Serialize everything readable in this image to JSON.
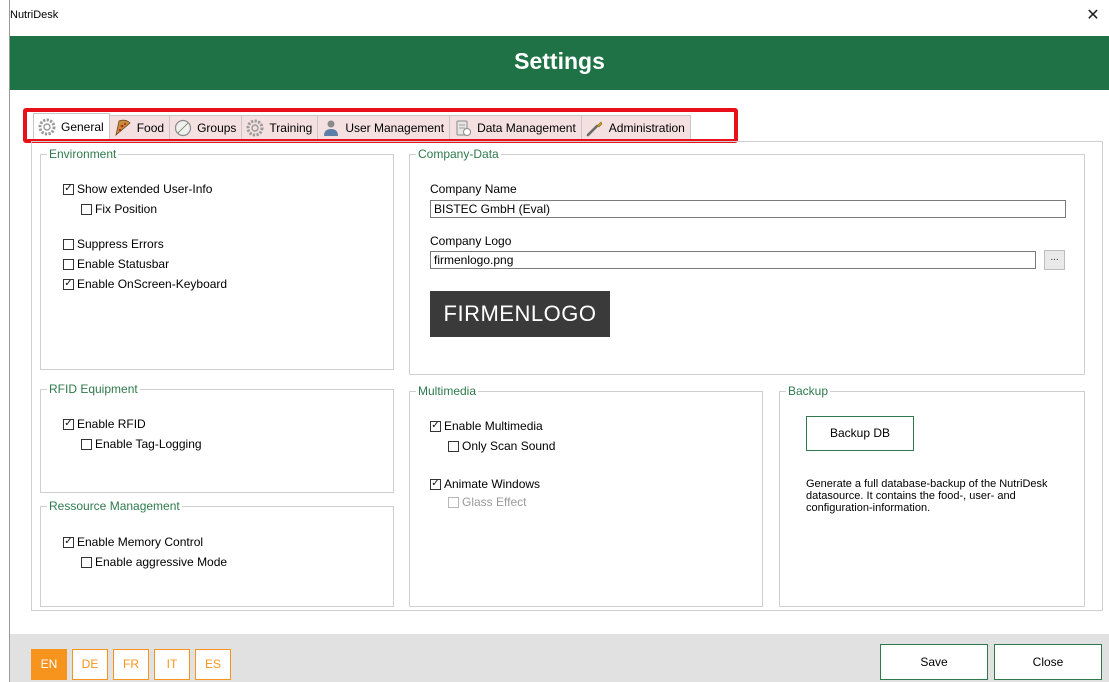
{
  "window": {
    "title": "NutriDesk",
    "close_glyph": "✕"
  },
  "header": {
    "title": "Settings"
  },
  "tabs": [
    {
      "label": "General",
      "icon": "gear-icon",
      "active": true
    },
    {
      "label": "Food",
      "icon": "pizza-icon"
    },
    {
      "label": "Groups",
      "icon": "compass-icon"
    },
    {
      "label": "Training",
      "icon": "gear-icon"
    },
    {
      "label": "User Management",
      "icon": "user-icon"
    },
    {
      "label": "Data Management",
      "icon": "database-icon"
    },
    {
      "label": "Administration",
      "icon": "wrench-icon"
    }
  ],
  "environment": {
    "title": "Environment",
    "show_extended_user_info": {
      "label": "Show extended User-Info",
      "checked": true
    },
    "fix_position": {
      "label": "Fix Position",
      "checked": false
    },
    "suppress_errors": {
      "label": "Suppress Errors",
      "checked": false
    },
    "enable_statusbar": {
      "label": "Enable Statusbar",
      "checked": false
    },
    "enable_onscreen_keyboard": {
      "label": "Enable OnScreen-Keyboard",
      "checked": true
    }
  },
  "company": {
    "title": "Company-Data",
    "name_label": "Company Name",
    "name_value": "BISTEC GmbH (Eval)",
    "logo_label": "Company Logo",
    "logo_value": "firmenlogo.png",
    "browse_label": "...",
    "logo_text": "FIRMENLOGO"
  },
  "rfid": {
    "title": "RFID Equipment",
    "enable_rfid": {
      "label": "Enable RFID",
      "checked": true
    },
    "enable_tag_logging": {
      "label": "Enable Tag-Logging",
      "checked": false
    }
  },
  "resource": {
    "title": "Ressource Management",
    "enable_memory_control": {
      "label": "Enable Memory Control",
      "checked": true
    },
    "enable_aggressive_mode": {
      "label": "Enable aggressive Mode",
      "checked": false
    }
  },
  "multimedia": {
    "title": "Multimedia",
    "enable_multimedia": {
      "label": "Enable Multimedia",
      "checked": true
    },
    "only_scan_sound": {
      "label": "Only Scan Sound",
      "checked": false
    },
    "animate_windows": {
      "label": "Animate Windows",
      "checked": true
    },
    "glass_effect": {
      "label": "Glass Effect",
      "checked": false,
      "disabled": true
    }
  },
  "backup": {
    "title": "Backup",
    "button_label": "Backup DB",
    "description": "Generate a full database-backup of the NutriDesk datasource. It contains the food-, user- and configuration-information."
  },
  "languages": [
    {
      "label": "EN",
      "active": true
    },
    {
      "label": "DE"
    },
    {
      "label": "FR"
    },
    {
      "label": "IT"
    },
    {
      "label": "ES"
    }
  ],
  "footer": {
    "save_label": "Save",
    "close_label": "Close"
  },
  "colors": {
    "header_green": "#1f7246",
    "accent_orange": "#f7941d",
    "highlight_red": "#e8111a"
  }
}
